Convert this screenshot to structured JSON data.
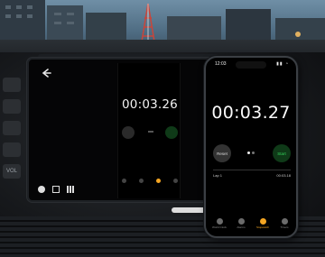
{
  "colors": {
    "start_green": "#35d15a",
    "start_bg": "#0f3a18",
    "reset_bg": "#333333",
    "active_tab": "#f5a623"
  },
  "car_screen": {
    "mirrored_time": "00:03.26",
    "icons": [
      "back-arrow-icon",
      "circle-icon",
      "expand-icon",
      "grid-icon"
    ]
  },
  "left_controls": [
    "",
    "",
    "",
    "",
    "VOL"
  ],
  "phone": {
    "status_time": "12:03",
    "time": "00:03.27",
    "reset_label": "Reset",
    "start_label": "Start",
    "lap_label": "Lap 1",
    "lap_time": "00:03.18",
    "tabs": [
      {
        "label": "World Clock",
        "icon": "globe-icon"
      },
      {
        "label": "Alarms",
        "icon": "alarm-icon"
      },
      {
        "label": "Stopwatch",
        "icon": "stopwatch-icon",
        "active": true
      },
      {
        "label": "Timers",
        "icon": "timer-icon"
      }
    ]
  }
}
